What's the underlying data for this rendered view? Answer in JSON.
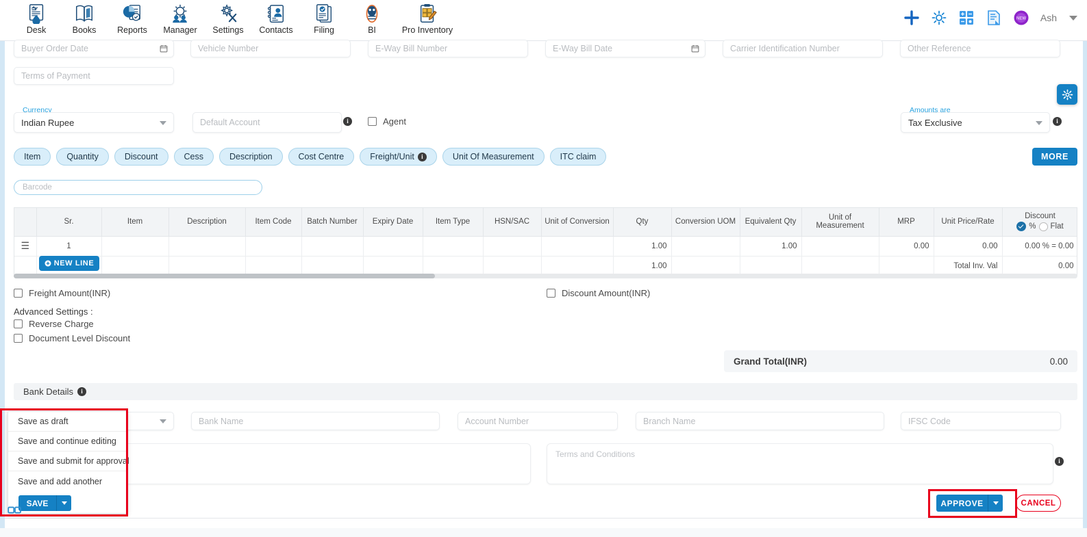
{
  "topnav": {
    "items": [
      {
        "label": "Desk",
        "icon": "desk-icon"
      },
      {
        "label": "Books",
        "icon": "books-icon"
      },
      {
        "label": "Reports",
        "icon": "reports-icon"
      },
      {
        "label": "Manager",
        "icon": "manager-icon"
      },
      {
        "label": "Settings",
        "icon": "settings-icon"
      },
      {
        "label": "Contacts",
        "icon": "contacts-icon"
      },
      {
        "label": "Filing",
        "icon": "filing-icon"
      },
      {
        "label": "BI",
        "icon": "bi-icon"
      },
      {
        "label": "Pro Inventory",
        "icon": "pro-inventory-icon"
      }
    ],
    "actions": [
      "plus-icon",
      "gear-icon",
      "apps-icon",
      "document-icon",
      "new-badge-icon"
    ],
    "user": "Ash"
  },
  "form": {
    "row1": [
      {
        "placeholder": "Buyer Order Date",
        "has_calendar": true
      },
      {
        "placeholder": "Vehicle Number",
        "has_calendar": false
      },
      {
        "placeholder": "E-Way Bill Number",
        "has_calendar": false
      },
      {
        "placeholder": "E-Way Bill Date",
        "has_calendar": true
      },
      {
        "placeholder": "Carrier Identification Number",
        "has_calendar": false
      },
      {
        "placeholder": "Other Reference",
        "has_calendar": false
      }
    ],
    "row2": [
      {
        "placeholder": "Terms of Payment",
        "has_calendar": false
      }
    ],
    "currency": {
      "label": "Currency",
      "value": "Indian Rupee"
    },
    "default_account": {
      "placeholder": "Default Account"
    },
    "agent": {
      "label": "Agent",
      "checked": false
    },
    "amounts_are": {
      "label": "Amounts are",
      "value": "Tax Exclusive"
    }
  },
  "chips": [
    {
      "label": "Item",
      "info": false
    },
    {
      "label": "Quantity",
      "info": false
    },
    {
      "label": "Discount",
      "info": false
    },
    {
      "label": "Cess",
      "info": false
    },
    {
      "label": "Description",
      "info": false
    },
    {
      "label": "Cost Centre",
      "info": false
    },
    {
      "label": "Freight/Unit",
      "info": true
    },
    {
      "label": "Unit Of Measurement",
      "info": false
    },
    {
      "label": "ITC claim",
      "info": false
    }
  ],
  "more_button": "MORE",
  "barcode": {
    "placeholder": "Barcode"
  },
  "table": {
    "columns": [
      "",
      "Sr.",
      "Item",
      "Description",
      "Item Code",
      "Batch Number",
      "Expiry Date",
      "Item Type",
      "HSN/SAC",
      "Unit of Conversion",
      "Qty",
      "Conversion UOM",
      "Equivalent Qty",
      "Unit of Measurement",
      "MRP",
      "Unit Price/Rate",
      "Discount"
    ],
    "discount_header": {
      "label": "Discount",
      "option_percent": "%",
      "option_flat": "Flat",
      "selected": "%"
    },
    "rows": [
      {
        "handle": "drag-handle-icon",
        "sr": "1",
        "item": "",
        "description": "",
        "item_code": "",
        "batch_number": "",
        "expiry_date": "",
        "item_type": "",
        "hsn_sac": "",
        "unit_of_conversion": "",
        "qty": "1.00",
        "conversion_uom": "",
        "equivalent_qty": "1.00",
        "unit_of_measurement": "",
        "mrp": "0.00",
        "unit_price_rate": "0.00",
        "discount": "0.00 % = 0.00"
      }
    ],
    "totals": {
      "qty": "1.00",
      "label": "Total Inv. Val",
      "value": "0.00"
    },
    "new_line_button": "NEW LINE"
  },
  "options": {
    "freight_amount": {
      "label": "Freight Amount(INR)",
      "checked": false
    },
    "discount_amount": {
      "label": "Discount Amount(INR)",
      "checked": false
    },
    "advanced_settings_title": "Advanced Settings :",
    "reverse_charge": {
      "label": "Reverse Charge",
      "checked": false
    },
    "document_level_discount": {
      "label": "Document Level Discount",
      "checked": false
    }
  },
  "grand_total": {
    "label": "Grand Total(INR)",
    "value": "0.00"
  },
  "bank_details": {
    "title": "Bank Details",
    "fields": [
      {
        "placeholder": "Bank Name"
      },
      {
        "placeholder": "Account Number"
      },
      {
        "placeholder": "Branch Name"
      },
      {
        "placeholder": "IFSC Code"
      }
    ]
  },
  "notes": {
    "placeholder": ""
  },
  "terms": {
    "placeholder": "Terms and Conditions"
  },
  "save_menu": {
    "items": [
      "Save as draft",
      "Save and continue editing",
      "Save and submit for approval",
      "Save and add another"
    ]
  },
  "save_button": "SAVE",
  "approve_button": "APPROVE",
  "cancel_button": "CANCEL",
  "colors": {
    "primary_blue": "#1581c4",
    "chip_blue": "#d9eefa",
    "highlight_red": "#e8001c",
    "label_blue": "#29a3e0",
    "rail_blue": "#d3e7f5"
  }
}
